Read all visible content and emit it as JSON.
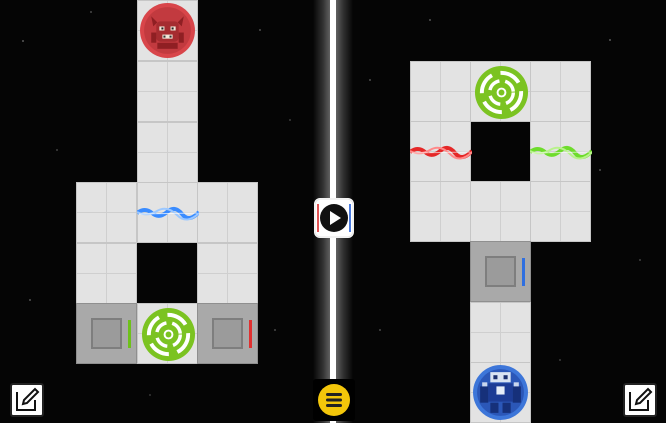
{
  "game": {
    "left_board": {
      "player": "red-bear-character",
      "portal": "green-portal",
      "laser": "blue-laser",
      "switches": [
        {
          "name": "switch-green",
          "color": "#6ec11a"
        },
        {
          "name": "switch-red",
          "color": "#e03030"
        }
      ]
    },
    "right_board": {
      "player": "blue-robot-character",
      "portal": "green-portal",
      "lasers": [
        "red-laser",
        "green-laser"
      ],
      "switches": [
        {
          "name": "switch-blue",
          "color": "#2f6fe0"
        }
      ]
    }
  },
  "controls": {
    "play_icon": "play-icon",
    "menu_icon": "menu-icon",
    "edit_icon": "edit-icon"
  },
  "colors": {
    "portal_green": "#7bc321",
    "laser_blue": "#3a8cff",
    "laser_red": "#e52828",
    "laser_green": "#6edc2c",
    "menu_yellow": "#f3c60a"
  }
}
